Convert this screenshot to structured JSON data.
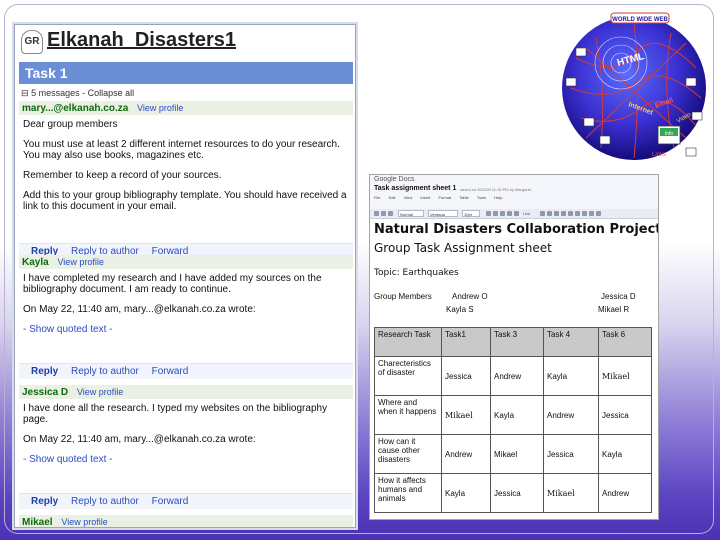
{
  "groups": {
    "logo_text": "GR",
    "group_name": "Elkanah_Disasters1",
    "topic": "Task 1",
    "message_count": "5 messages",
    "collapse_label": "Collapse all",
    "messages": [
      {
        "sender": "mary...@elkanah.co.za",
        "view_profile": "View profile",
        "lines": [
          "Dear group members",
          "You must use at least 2 different internet resources to do your research. You may also use books, magazines etc.",
          "Remember to keep a record of your sources.",
          "Add this to your group bibliography template. You should have received a link to this document in your email."
        ]
      },
      {
        "sender": "Kayla",
        "view_profile": "View profile",
        "lines": [
          "I have completed my research and I have added my sources on the bibliography document. I am ready to continue.",
          "On May 22, 11:40 am, mary...@elkanah.co.za wrote:"
        ],
        "show_quoted": "- Show quoted text -"
      },
      {
        "sender": "Jessica D",
        "view_profile": "View profile",
        "lines": [
          "I have done all the research. I typed my websites on the bibliography page.",
          "On May 22, 11:40 am, mary...@elkanah.co.za wrote:"
        ],
        "show_quoted": "- Show quoted text -"
      },
      {
        "sender": "Mikael",
        "view_profile": "View profile"
      }
    ],
    "actions": {
      "reply": "Reply",
      "reply_author": "Reply to author",
      "forward": "Forward"
    }
  },
  "docs": {
    "logo": "Google Docs",
    "doc_title": "Task assignment sheet 1",
    "meta": "saved on 5/22/09 11:16 PM by Margaret",
    "menu": [
      "File",
      "Edit",
      "View",
      "Insert",
      "Format",
      "Table",
      "Tools",
      "Help"
    ],
    "toolbar_style": "Normal",
    "toolbar_font": "Verdana",
    "toolbar_size": "10pt",
    "toolbar_link": "Link",
    "heading": "Natural Disasters Collaboration Project Gr",
    "subheading": "Group Task Assignment sheet",
    "topic": "Topic:  Earthquakes",
    "members_label": "Group Members",
    "members": [
      "Andrew O",
      "Kayla S",
      "Jessica D",
      "Mikael R"
    ],
    "table": {
      "headers": [
        "Research Task",
        "Task1",
        "Task 3",
        "Task 4",
        "Task 6"
      ],
      "rows": [
        [
          "Charecteristics of disaster",
          "Jessica",
          "Andrew",
          "Kayla",
          "Mikael"
        ],
        [
          "Where and when it happens",
          "Mikael",
          "Kayla",
          "Andrew",
          "Jessica"
        ],
        [
          "How can it cause other disasters",
          "Andrew",
          "Mikael",
          "Jessica",
          "Kayla"
        ],
        [
          "How it affects humans and animals",
          "Kayla",
          "Jessica",
          "Mikael",
          "Andrew"
        ]
      ]
    }
  },
  "clipart": {
    "labels": [
      "WORLD WIDE WEB",
      "HTML",
      "Internet",
      "Email",
      "Info",
      "Video",
      "Links"
    ],
    "globe_color": "#3a2fd0",
    "accent_color": "#d23a3a"
  }
}
